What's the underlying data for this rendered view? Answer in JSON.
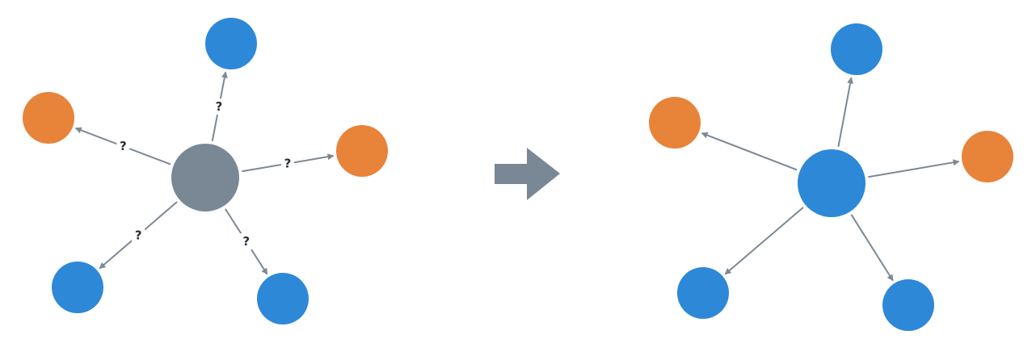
{
  "colors": {
    "blue": "#2d88d8",
    "orange": "#e8833a",
    "gray": "#7a8896",
    "edge": "#7c8894",
    "label_text": "#2b2f33",
    "label_bg": "#ffffff"
  },
  "graphs": {
    "before": {
      "center_color": "gray",
      "leaves": [
        {
          "name": "leaf-top",
          "color": "blue",
          "edge_label": "?"
        },
        {
          "name": "leaf-right",
          "color": "orange",
          "edge_label": "?"
        },
        {
          "name": "leaf-bottom-right",
          "color": "blue",
          "edge_label": "?"
        },
        {
          "name": "leaf-bottom-left",
          "color": "blue",
          "edge_label": "?"
        },
        {
          "name": "leaf-left",
          "color": "orange",
          "edge_label": "?"
        }
      ]
    },
    "after": {
      "center_color": "blue",
      "leaves": [
        {
          "name": "leaf-top",
          "color": "blue",
          "edge_label": ""
        },
        {
          "name": "leaf-right",
          "color": "orange",
          "edge_label": ""
        },
        {
          "name": "leaf-bottom-right",
          "color": "blue",
          "edge_label": ""
        },
        {
          "name": "leaf-bottom-left",
          "color": "blue",
          "edge_label": ""
        },
        {
          "name": "leaf-left",
          "color": "orange",
          "edge_label": ""
        }
      ]
    }
  },
  "transition_arrow": {
    "icon": "right-arrow-icon",
    "color": "gray"
  }
}
